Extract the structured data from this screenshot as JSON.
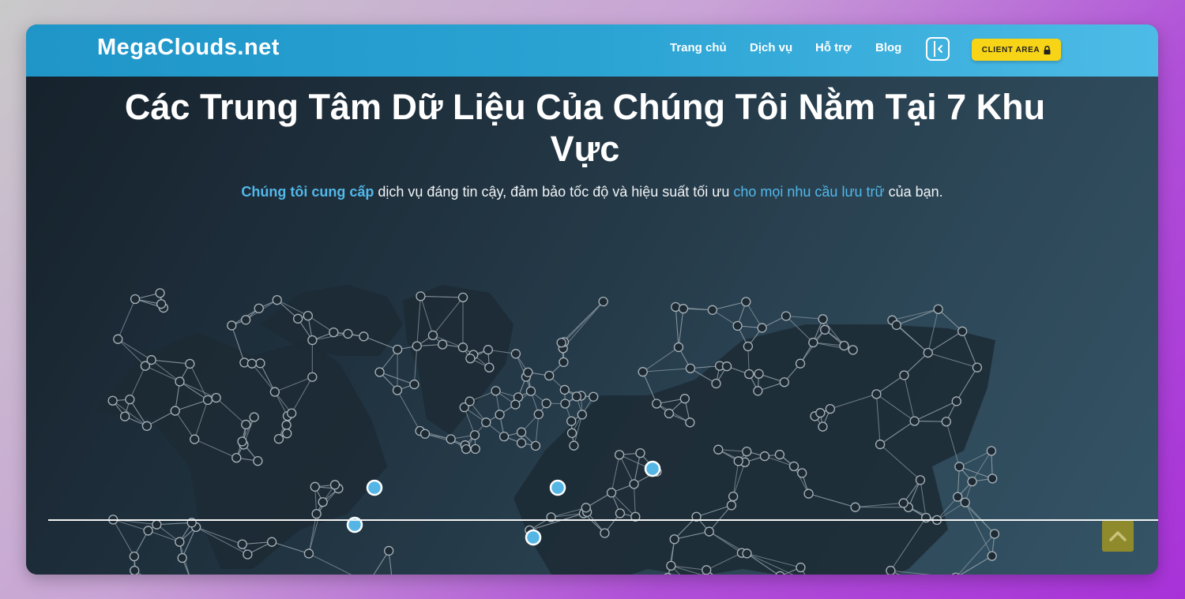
{
  "header": {
    "logo": "MegaClouds.net",
    "nav": [
      "Trang chủ",
      "Dịch vụ",
      "Hỗ trợ",
      "Blog"
    ],
    "client_area_label": "CLIENT AREA"
  },
  "hero": {
    "title": "Các Trung Tâm Dữ Liệu Của Chúng Tôi Nằm Tại 7 Khu Vực",
    "subtitle": {
      "highlight1": "Chúng tôi cung cấp",
      "text1": " dịch vụ đáng tin cậy, đảm bảo tốc độ và hiệu suất tối ưu ",
      "highlight2": "cho mọi nhu cầu lưu trữ",
      "text2": " của bạn."
    }
  },
  "icons": {
    "lock": "lock-icon",
    "sidebar_toggle": "sidebar-toggle-icon",
    "scroll_top": "chevron-up-icon"
  },
  "colors": {
    "nav_gradient_start": "#1f95c8",
    "nav_gradient_end": "#4dbbe6",
    "client_button": "#f7d415",
    "accent_text": "#52b8ea",
    "datacenter_marker": "#55b6e6",
    "scroll_button": "#8f8b2c"
  }
}
